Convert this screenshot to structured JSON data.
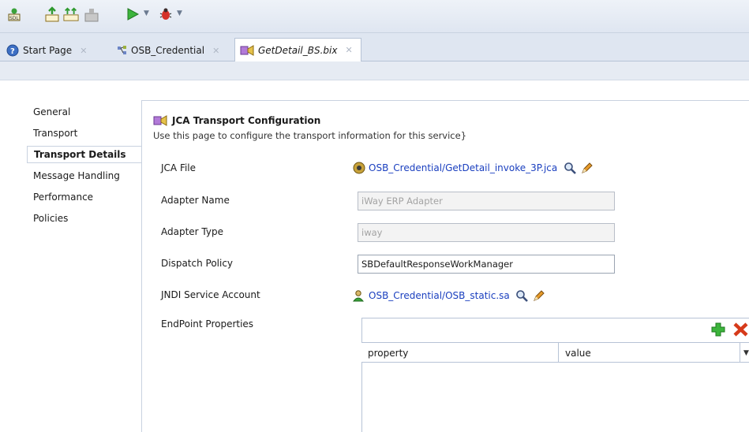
{
  "toolbar": {
    "icons": [
      "sdl-icon",
      "deploy-icon",
      "deploy-all-icon",
      "undeploy-icon",
      "run-icon",
      "debug-icon"
    ]
  },
  "tabs": [
    {
      "label": "Start Page",
      "icon": "help-circle-icon"
    },
    {
      "label": "OSB_Credential",
      "icon": "project-icon"
    },
    {
      "label": "GetDetail_BS.bix",
      "icon": "business-service-icon",
      "active": true
    }
  ],
  "nav": {
    "items": [
      {
        "label": "General"
      },
      {
        "label": "Transport"
      },
      {
        "label": "Transport Details",
        "selected": true
      },
      {
        "label": "Message Handling"
      },
      {
        "label": "Performance"
      },
      {
        "label": "Policies"
      }
    ]
  },
  "page": {
    "title": "JCA Transport Configuration",
    "description": "Use this page to configure the transport information for this service}"
  },
  "form": {
    "jca_file_label": "JCA File",
    "jca_file_value": "OSB_Credential/GetDetail_invoke_3P.jca",
    "adapter_name_label": "Adapter Name",
    "adapter_name_value": "iWay ERP Adapter",
    "adapter_type_label": "Adapter Type",
    "adapter_type_value": "iway",
    "dispatch_policy_label": "Dispatch Policy",
    "dispatch_policy_value": "SBDefaultResponseWorkManager",
    "jndi_label": "JNDI Service Account",
    "jndi_value": "OSB_Credential/OSB_static.sa",
    "endpoint_label": "EndPoint Properties"
  },
  "endpoint_table": {
    "columns": [
      "property",
      "value"
    ],
    "rows": []
  },
  "colors": {
    "link": "#1a3fbf",
    "add": "#2fa82f",
    "remove": "#d63a1a"
  }
}
